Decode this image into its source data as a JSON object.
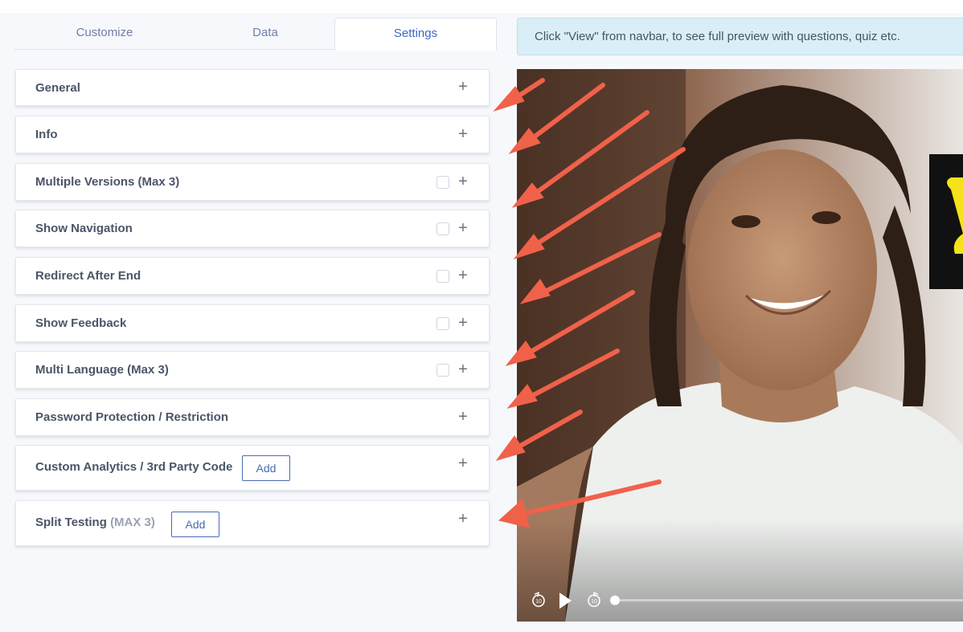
{
  "tabs": [
    {
      "label": "Customize"
    },
    {
      "label": "Data"
    },
    {
      "label": "Settings",
      "active": true
    }
  ],
  "notice": {
    "text": "Click \"View\" from navbar, to see full preview with questions, quiz etc."
  },
  "panels": [
    {
      "label": "General",
      "has_checkbox": false
    },
    {
      "label": "Info",
      "has_checkbox": false
    },
    {
      "label": "Multiple Versions (Max 3)",
      "has_checkbox": true,
      "checked": false
    },
    {
      "label": "Show Navigation",
      "has_checkbox": true,
      "checked": false
    },
    {
      "label": "Redirect After End",
      "has_checkbox": true,
      "checked": false
    },
    {
      "label": "Show Feedback",
      "has_checkbox": true,
      "checked": false
    },
    {
      "label": "Multi Language (Max 3)",
      "has_checkbox": true,
      "checked": false
    },
    {
      "label": "Password Protection / Restriction",
      "has_checkbox": false
    },
    {
      "label": "Custom Analytics / 3rd Party Code",
      "has_checkbox": false,
      "button_label": "Add"
    },
    {
      "label": "Split Testing",
      "label_muted": "(MAX 3)",
      "has_checkbox": false,
      "button_label": "Add"
    }
  ],
  "icons": {
    "expand": "+",
    "expand_name": "plus-icon",
    "rewind_name": "rewind-10-icon",
    "play_name": "play-icon",
    "forward_name": "forward-10-icon"
  },
  "video": {
    "progress": 0
  },
  "colors": {
    "accent": "#3b68c4",
    "arrow": "#f0614a",
    "notice_bg": "#d9eef6"
  }
}
